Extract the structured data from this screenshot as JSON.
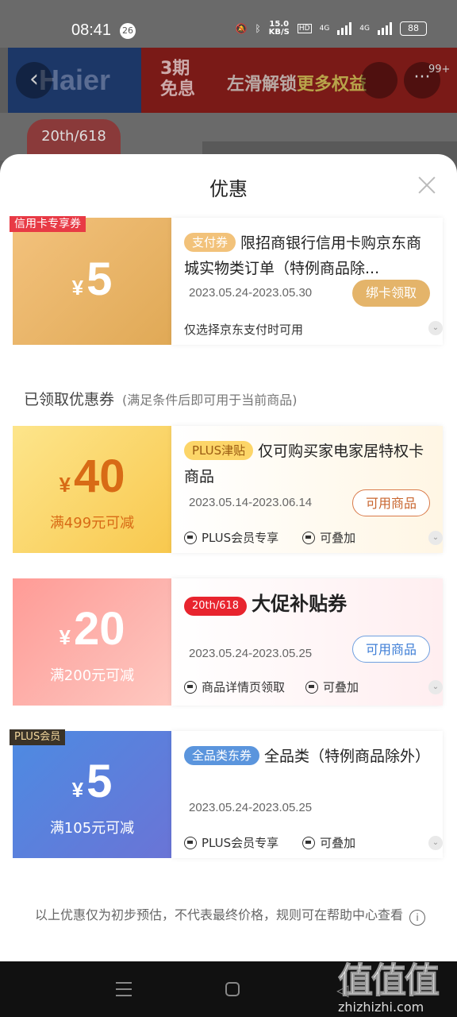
{
  "status": {
    "time": "08:41",
    "notif_count": "26",
    "speed_top": "15.0",
    "speed_unit": "KB/S",
    "hd": "HD",
    "net1": "4G",
    "net2": "4G",
    "battery": "88"
  },
  "background": {
    "brand": "Haier",
    "promo_left": "3期\n免息",
    "promo_text": "左滑解锁",
    "promo_highlight": "更多权益",
    "badge": "99+",
    "logo618": "20th/618"
  },
  "sheet": {
    "title": "优惠"
  },
  "coupons": [
    {
      "corner": "信用卡专享券",
      "currency": "¥",
      "amount": "5",
      "condition": "",
      "tag": "支付券",
      "desc": "限招商银行信用卡购京东商城实物类订单（特例商品除...",
      "dates": "2023.05.24-2023.05.30",
      "button": "绑卡领取",
      "foot1": "仅选择京东支付时可用",
      "foot2": ""
    },
    {
      "corner": "",
      "currency": "¥",
      "amount": "40",
      "condition": "满499元可减",
      "tag": "PLUS津贴",
      "desc": "仅可购买家电家居特权卡商品",
      "dates": "2023.05.14-2023.06.14",
      "button": "可用商品",
      "foot1": "PLUS会员专享",
      "foot2": "可叠加"
    },
    {
      "corner": "",
      "currency": "¥",
      "amount": "20",
      "condition": "满200元可减",
      "tag": "20th/618",
      "desc": "大促补贴券",
      "dates": "2023.05.24-2023.05.25",
      "button": "可用商品",
      "foot1": "商品详情页领取",
      "foot2": "可叠加"
    },
    {
      "corner": "PLUS会员",
      "currency": "¥",
      "amount": "5",
      "condition": "满105元可减",
      "tag": "全品类东券",
      "desc": "全品类（特例商品除外）",
      "dates": "2023.05.24-2023.05.25",
      "button": "",
      "foot1": "PLUS会员专享",
      "foot2": "可叠加"
    }
  ],
  "section": {
    "title": "已领取优惠券",
    "subtitle": "(满足条件后即可用于当前商品)"
  },
  "disclaimer": "以上优惠仅为初步预估，不代表最终价格，规则可在帮助中心查看",
  "info_icon": "i",
  "watermark": {
    "big": "值值值",
    "small": "zhizhizhi.com"
  },
  "colors": {
    "gold": "#e7b56a",
    "plus": "#fbd86a",
    "red": "#ff8b8b",
    "blue": "#5b7fd8"
  }
}
